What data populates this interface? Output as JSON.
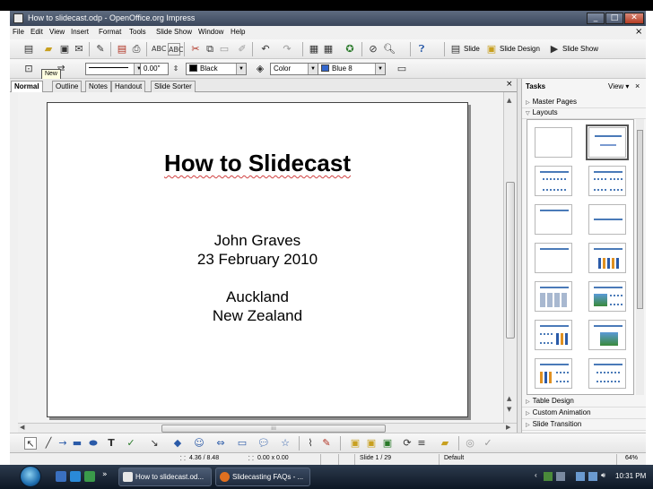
{
  "window": {
    "title": "How to slidecast.odp - OpenOffice.org Impress",
    "minimize": "_",
    "maximize": "□",
    "close": "✕"
  },
  "menu": {
    "items": [
      "File",
      "Edit",
      "View",
      "Insert",
      "Format",
      "Tools",
      "Slide Show",
      "Window",
      "Help"
    ],
    "close_doc": "×"
  },
  "toolbar1": {
    "slide_label": "Slide",
    "slide_design_label": "Slide Design",
    "slide_show_label": "Slide Show"
  },
  "toolbar2": {
    "line_width": "0.00\"",
    "line_color": "Black",
    "area_style": "Color",
    "area_color": "Blue 8",
    "tooltip": "New",
    "colors": {
      "black": "#000000",
      "blue8": "#3366cc"
    }
  },
  "tabs": [
    "Normal",
    "Outline",
    "Notes",
    "Handout",
    "Slide Sorter"
  ],
  "tab_close": "×",
  "slide": {
    "title": "How to Slidecast",
    "author": "John Graves",
    "date": "23 February 2010",
    "city": "Auckland",
    "country": "New Zealand"
  },
  "taskpane": {
    "title": "Tasks",
    "view_menu": "View ▾",
    "close": "×",
    "sections": {
      "master_pages": "Master Pages",
      "layouts": "Layouts",
      "table_design": "Table Design",
      "custom_animation": "Custom Animation",
      "slide_transition": "Slide Transition"
    }
  },
  "statusbar": {
    "position": "4.36 / 8.48",
    "size": "0.00 x 0.00",
    "slide": "Slide 1 / 29",
    "master": "Default",
    "zoom": "64%"
  },
  "taskbar": {
    "items": [
      "How to slidecast.od...",
      "Slidecasting FAQs - ..."
    ],
    "time": "10:31 PM",
    "chevron": "»"
  }
}
